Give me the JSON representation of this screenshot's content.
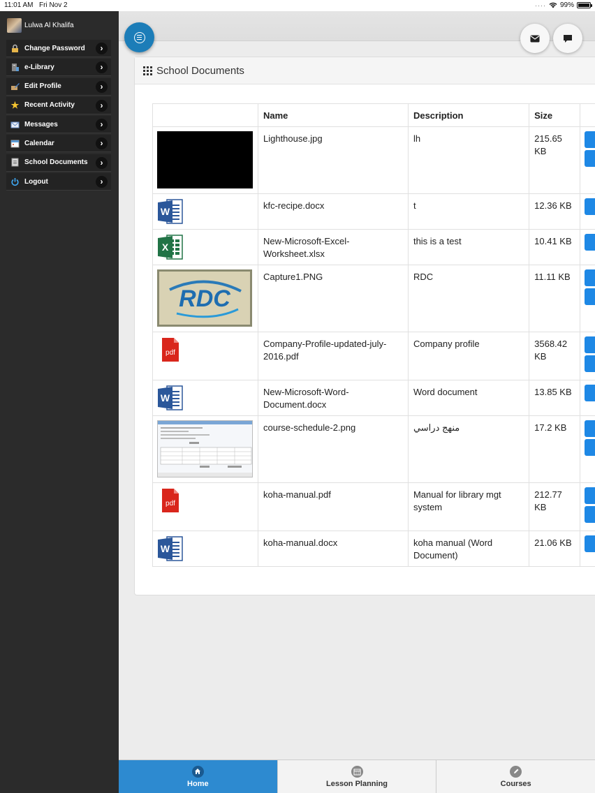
{
  "status_bar": {
    "time": "11:01 AM",
    "date": "Fri Nov 2",
    "battery": "99%"
  },
  "user": {
    "name": "Lulwa Al Khalifa"
  },
  "sidebar": {
    "items": [
      {
        "label": "Change Password",
        "icon": "lock-icon"
      },
      {
        "label": "e-Library",
        "icon": "library-icon"
      },
      {
        "label": "Edit Profile",
        "icon": "edit-profile-icon"
      },
      {
        "label": "Recent Activity",
        "icon": "star-icon"
      },
      {
        "label": "Messages",
        "icon": "mail-icon"
      },
      {
        "label": "Calendar",
        "icon": "calendar-icon"
      },
      {
        "label": "School Documents",
        "icon": "document-icon"
      },
      {
        "label": "Logout",
        "icon": "power-icon"
      }
    ]
  },
  "panel": {
    "title": "School Documents"
  },
  "table": {
    "headers": [
      "",
      "Name",
      "Description",
      "Size",
      ""
    ],
    "rows": [
      {
        "thumb": "image-black",
        "name": "Lighthouse.jpg",
        "description": "lh",
        "size": "215.65 KB",
        "actions": 2
      },
      {
        "thumb": "word",
        "name": "kfc-recipe.docx",
        "description": "t",
        "size": "12.36 KB",
        "actions": 1
      },
      {
        "thumb": "excel",
        "name": "New-Microsoft-Excel-Worksheet.xlsx",
        "description": "this is a test",
        "size": "10.41 KB",
        "actions": 1
      },
      {
        "thumb": "image-rdc",
        "name": "Capture1.PNG",
        "description": "RDC",
        "size": "11.11 KB",
        "actions": 2
      },
      {
        "thumb": "pdf",
        "name": "Company-Profile-updated-july-2016.pdf",
        "description": "Company profile",
        "size": "3568.42 KB",
        "actions": 2
      },
      {
        "thumb": "word",
        "name": "New-Microsoft-Word-Document.docx",
        "description": "Word document",
        "size": "13.85 KB",
        "actions": 1
      },
      {
        "thumb": "image-schedule",
        "name": "course-schedule-2.png",
        "description": "منهج دراسي",
        "size": "17.2 KB",
        "actions": 2
      },
      {
        "thumb": "pdf",
        "name": "koha-manual.pdf",
        "description": "Manual for library mgt system",
        "size": "212.77 KB",
        "actions": 2
      },
      {
        "thumb": "word",
        "name": "koha-manual.docx",
        "description": "koha manual (Word Document)",
        "size": "21.06 KB",
        "actions": 1
      }
    ]
  },
  "rdc_text": "RDC",
  "pdf_text": "pdf",
  "bottom_nav": [
    {
      "label": "Home",
      "icon": "home-icon",
      "active": true
    },
    {
      "label": "Lesson Planning",
      "icon": "calendar-icon",
      "active": false
    },
    {
      "label": "Courses",
      "icon": "pencil-icon",
      "active": false
    }
  ],
  "colors": {
    "accent": "#1c7db8",
    "action": "#1e88e5",
    "active_tab": "#2d8ad0",
    "sidebar_bg": "#2b2b2b"
  }
}
